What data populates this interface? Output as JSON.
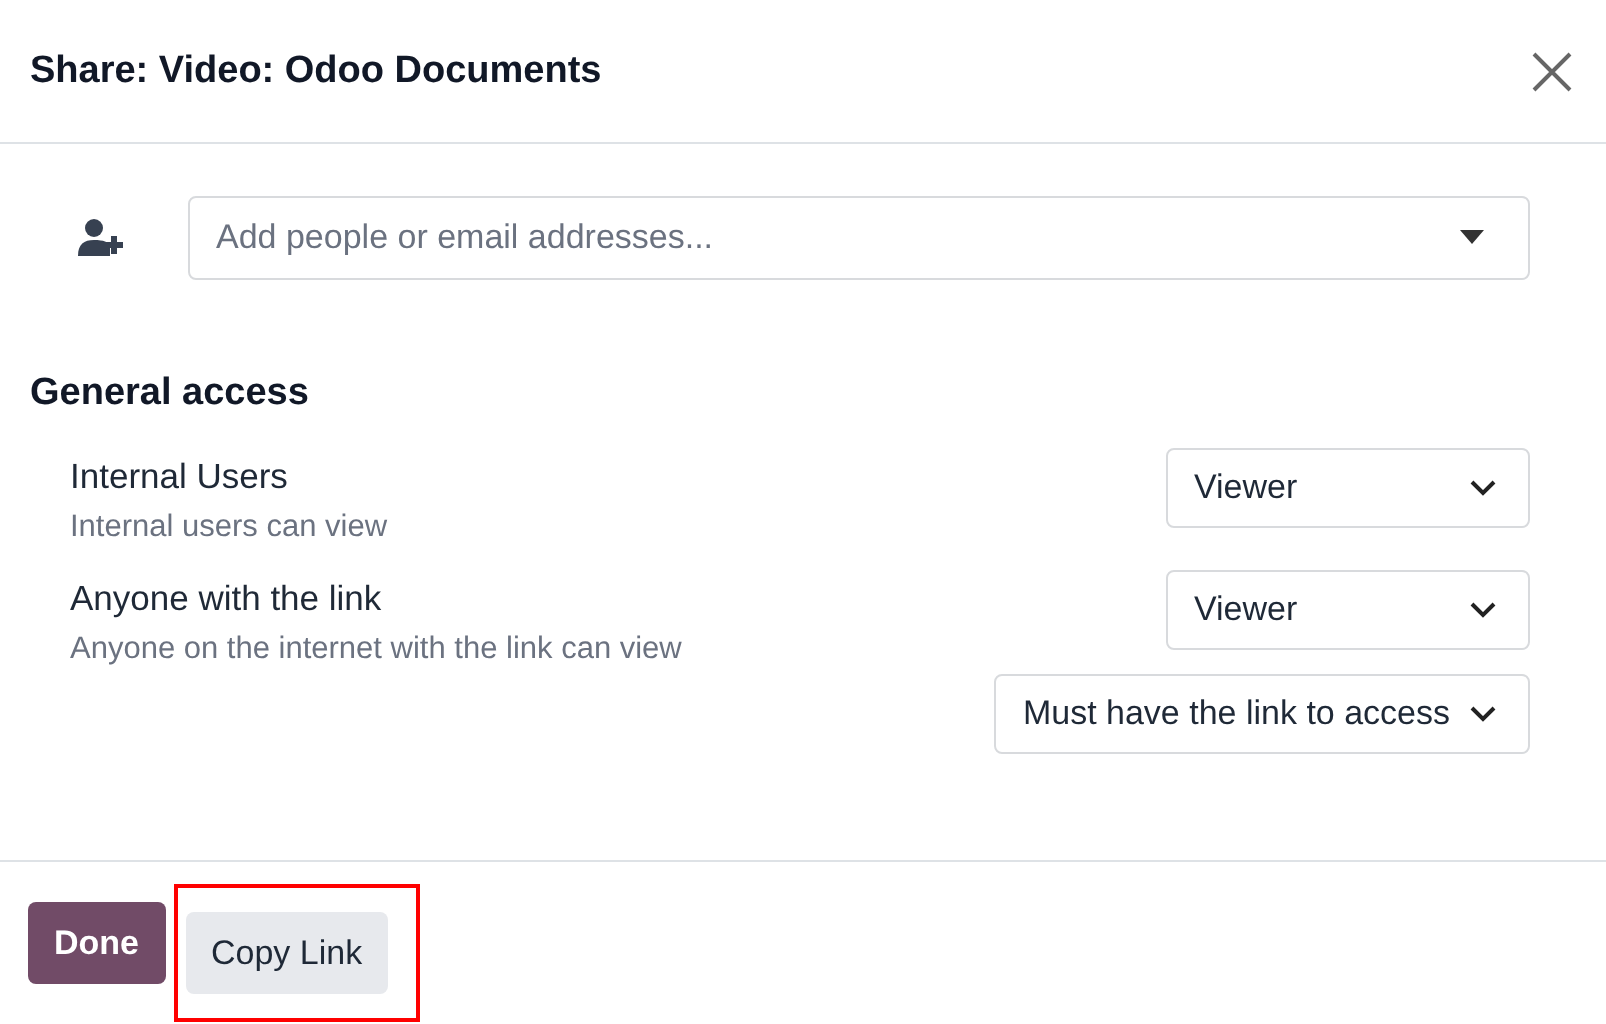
{
  "dialog": {
    "title": "Share: Video: Odoo Documents"
  },
  "invite": {
    "placeholder": "Add people or email addresses..."
  },
  "general_access": {
    "heading": "General access",
    "rows": [
      {
        "title": "Internal Users",
        "description": "Internal users can view",
        "selects": [
          "Viewer"
        ]
      },
      {
        "title": "Anyone with the link",
        "description": "Anyone on the internet with the link can view",
        "selects": [
          "Viewer",
          "Must have the link to access"
        ]
      }
    ]
  },
  "buttons": [
    {
      "label": "Done",
      "kind": "primary",
      "highlighted": false
    },
    {
      "label": "Copy Link",
      "kind": "secondary",
      "highlighted": true
    }
  ]
}
